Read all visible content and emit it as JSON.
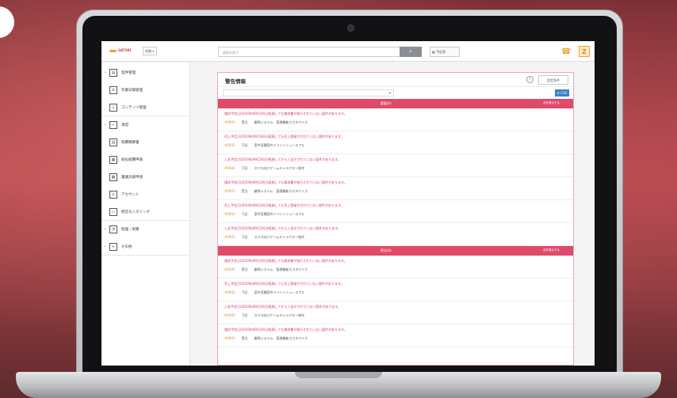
{
  "app": {
    "logo": "SATORI",
    "org_select": "組織",
    "search_placeholder": "検索を探す",
    "schedule_label": "予定表",
    "user_initial": "Z"
  },
  "sidebar": {
    "items": [
      {
        "label": "案件管理",
        "icon": "folder-icon",
        "arrow": "›"
      },
      {
        "label": "作業日報管理",
        "icon": "document-icon",
        "arrow": ""
      },
      {
        "label": "コンテンツ管理",
        "icon": "phone-icon",
        "arrow": ""
      },
      {
        "label": "承認",
        "icon": "checkbox-icon",
        "arrow": "›"
      },
      {
        "label": "経費精算書",
        "icon": "receipt-icon",
        "arrow": ""
      },
      {
        "label": "仮払経費申請",
        "icon": "form-icon",
        "arrow": ""
      },
      {
        "label": "稟議決裁申請",
        "icon": "form-icon",
        "arrow": ""
      },
      {
        "label": "アカウント",
        "icon": "person-icon",
        "arrow": ""
      },
      {
        "label": "経営モニタリング",
        "icon": "monitor-icon",
        "arrow": ""
      },
      {
        "label": "経理・財務",
        "icon": "chart-icon",
        "arrow": "›"
      },
      {
        "label": "その他",
        "icon": "plus-icon",
        "arrow": "›"
      }
    ]
  },
  "panel": {
    "title": "警告情報",
    "settings_label": "設定条件",
    "filter_value": "▾",
    "csv_label": "⬇ CSV"
  },
  "sections": [
    {
      "title": "重要(6)",
      "all_label": "全件表示する",
      "alerts": [
        {
          "message": "請求予定日(2019年09月30日)経過しても請求書が発行されていない案件があります。",
          "code": "0001",
          "code_prefix": "#0001",
          "type": "受注",
          "project": "顧問システム　管理機能カスタマイズ"
        },
        {
          "message": "売上予定日(2019年09月30日)経過しても売上登録がされていない案件があります。",
          "code": "0002",
          "code_prefix": "#0002",
          "type": "下記",
          "project": "案件見積案件イベントニュースアル"
        },
        {
          "message": "入金予定日(2019年09月30日)経過してから入金がされていない案件があります。",
          "code": "0003",
          "code_prefix": "#0003",
          "type": "下記",
          "project": "スマホ向けゲームキャラクター制作"
        },
        {
          "message": "請求予定日(2019年09月30日)経過しても請求書が発行されていない案件があります。",
          "code": "0001",
          "code_prefix": "#0001",
          "type": "受注",
          "project": "顧問システム　管理機能カスタマイズ"
        },
        {
          "message": "売上予定日(2019年09月30日)経過しても売上登録がされていない案件があります。",
          "code": "0002",
          "code_prefix": "#0002",
          "type": "下記",
          "project": "案件見積案件イベントニュースアル"
        },
        {
          "message": "入金予定日(2019年09月30日)経過してから入金がされていない案件があります。",
          "code": "0003",
          "code_prefix": "#0003",
          "type": "下記",
          "project": "スマホ向けゲームキャラクター制作"
        }
      ]
    },
    {
      "title": "警告(6)",
      "all_label": "全件表示する",
      "alerts": [
        {
          "message": "請求予定日(2019年09月30日)経過しても請求書が発行されていない案件があります。",
          "code": "0001",
          "code_prefix": "#0001",
          "type": "受注",
          "project": "顧問システム　管理機能カスタマイズ"
        },
        {
          "message": "売上予定日(2019年09月30日)経過しても売上登録がされていない案件があります。",
          "code": "0002",
          "code_prefix": "#0002",
          "type": "下記",
          "project": "案件見積案件イベントニュースアル"
        },
        {
          "message": "入金予定日(2019年09月30日)経過してから入金がされていない案件があります。",
          "code": "0003",
          "code_prefix": "#0003",
          "type": "下記",
          "project": "スマホ向けゲームキャラクター制作"
        },
        {
          "message": "請求予定日(2019年09月30日)経過しても請求書が発行されていない案件があります。",
          "code": "0001",
          "code_prefix": "#0001",
          "type": "受注",
          "project": "顧問システム　管理機能カスタマイズ"
        }
      ]
    }
  ],
  "colors": {
    "accent": "#e04a6a",
    "alert_text": "#d7335a",
    "code": "#e08a2a",
    "csv": "#3d82c4"
  }
}
